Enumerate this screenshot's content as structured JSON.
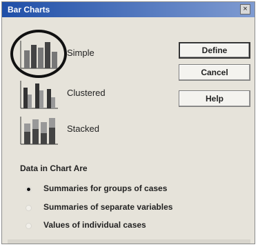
{
  "window": {
    "title": "Bar Charts",
    "close_glyph": "×"
  },
  "chart_types": [
    {
      "label": "Simple",
      "icon": "simple-bar-chart-icon",
      "selected": true
    },
    {
      "label": "Clustered",
      "icon": "clustered-bar-chart-icon",
      "selected": false
    },
    {
      "label": "Stacked",
      "icon": "stacked-bar-chart-icon",
      "selected": false
    }
  ],
  "buttons": {
    "define": "Define",
    "cancel": "Cancel",
    "help": "Help"
  },
  "data_section": {
    "label": "Data in Chart Are",
    "options": [
      {
        "label": "Summaries for groups of cases",
        "checked": true
      },
      {
        "label": "Summaries of separate variables",
        "checked": false
      },
      {
        "label": "Values of individual cases",
        "checked": false
      }
    ]
  },
  "colors": {
    "title_bar": "#1f4fa8",
    "dialog_bg": "#e6e3da"
  }
}
